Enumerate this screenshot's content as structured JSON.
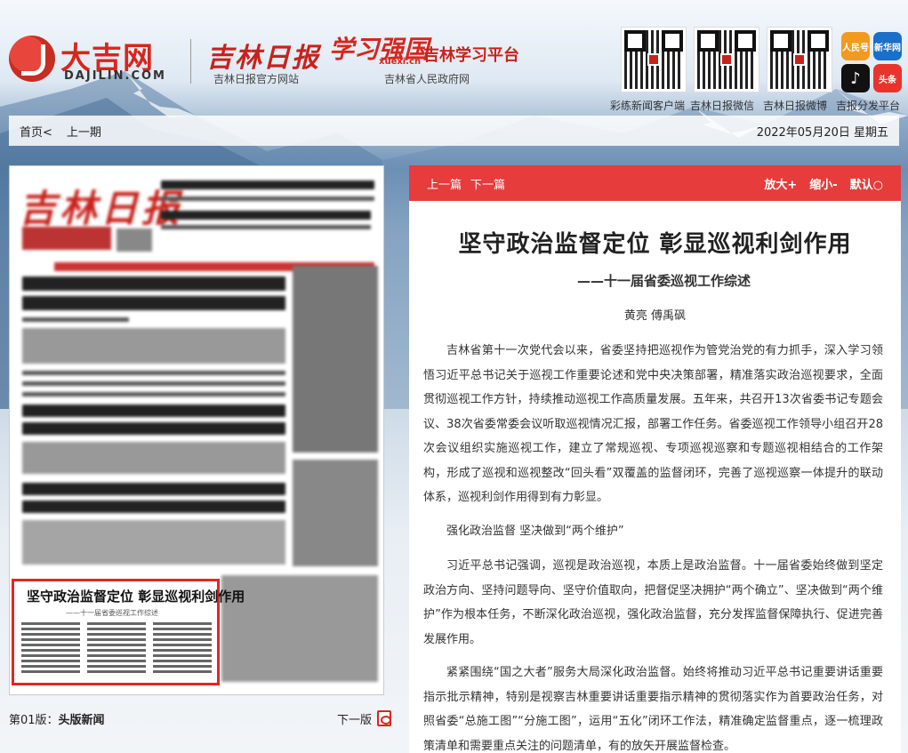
{
  "header": {
    "site_logo_text": "大吉网",
    "site_logo_sub": "DAJILIN.COM",
    "jlrb_logo": "吉林日报",
    "jlrb_sub": "吉林日报官方网站",
    "xxqg_logo": "学习强国",
    "xxqg_url": "xuexi.cn",
    "xxqg_title": "吉林学习平台",
    "xxqg_sub": "吉林省人民政府网",
    "qr_codes": [
      {
        "label": "彩练新闻客户端"
      },
      {
        "label": "吉林日报微信"
      },
      {
        "label": "吉林日报微博"
      }
    ],
    "apps": [
      {
        "name": "人民号",
        "icon": "renminhao-icon",
        "color": "#f29a1f"
      },
      {
        "name": "新华网",
        "icon": "xinhua-icon",
        "color": "#1b6fc8"
      },
      {
        "name": "抖音",
        "icon": "douyin-icon",
        "color": "#111111"
      },
      {
        "name": "头条",
        "icon": "toutiao-icon",
        "color": "#e8342c"
      }
    ],
    "apps_label": "吉报分发平台"
  },
  "nav": {
    "home": "首页<",
    "prev_issue": "上一期",
    "date": "2022年05月20日  星期五"
  },
  "paper": {
    "masthead": "吉林日报",
    "highlight_title": "坚守政治监督定位  彰显巡视利剑作用",
    "highlight_sub": "——十一届省委巡视工作综述",
    "page_label": "第01版：",
    "page_name": "头版新闻",
    "next_page": "下一版"
  },
  "article": {
    "prev": "上一篇",
    "next": "下一篇",
    "zoom_in": "放大+",
    "zoom_out": "缩小-",
    "default": "默认",
    "title": "坚守政治监督定位 彰显巡视利剑作用",
    "subtitle": "——十一届省委巡视工作综述",
    "author": "黄亮 傅禹砜",
    "p1": "吉林省第十一次党代会以来，省委坚持把巡视作为管党治党的有力抓手，深入学习领悟习近平总书记关于巡视工作重要论述和党中央决策部署，精准落实政治巡视要求，全面贯彻巡视工作方针，持续推动巡视工作高质量发展。五年来，共召开13次省委书记专题会议、38次省委常委会议听取巡视情况汇报，部署工作任务。省委巡视工作领导小组召开28次会议组织实施巡视工作，建立了常规巡视、专项巡视巡察和专题巡视相结合的工作架构，形成了巡视和巡视整改“回头看”双覆盖的监督闭环，完善了巡视巡察一体提升的联动体系，巡视利剑作用得到有力彰显。",
    "h1": "强化政治监督 坚决做到“两个维护”",
    "p2": "习近平总书记强调，巡视是政治巡视，本质上是政治监督。十一届省委始终做到坚定政治方向、坚持问题导向、坚守价值取向，把督促坚决拥护“两个确立”、坚决做到“两个维护”作为根本任务，不断深化政治巡视，强化政治监督，充分发挥监督保障执行、促进完善发展作用。",
    "p3": "紧紧围绕“国之大者”服务大局深化政治监督。始终将推动习近平总书记重要讲话重要指示批示精神，特别是视察吉林重要讲话重要指示精神的贯彻落实作为首要政治任务，对照省委“总施工图”“分施工图”，运用“五化”闭环工作法，精准确定监督重点，逐一梳理政策清单和需要重点关注的问题清单，有的放矢开展监督检查。"
  }
}
